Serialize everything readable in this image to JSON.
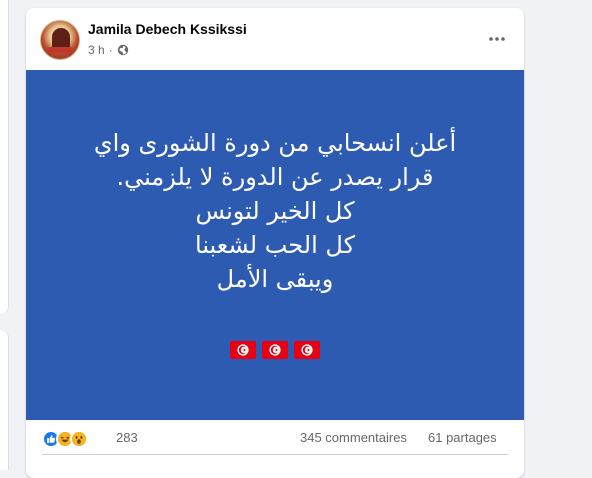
{
  "post": {
    "author": "Jamila Debech Kssikssi",
    "time": "3 h",
    "dot": "·",
    "privacy_icon": "globe-icon",
    "more_icon": "ellipsis-icon",
    "background_color": "#2e5bb2",
    "text_lines": [
      "أعلن انسحابي من دورة الشورى واي",
      "قرار يصدر عن الدورة لا يلزمني.",
      "كل الخير لتونس",
      "كل الحب لشعبنا",
      "ويبقى الأمل"
    ],
    "flags": [
      "tunisia-flag-icon",
      "tunisia-flag-icon",
      "tunisia-flag-icon"
    ]
  },
  "reactions": {
    "icons": [
      "like-icon",
      "haha-icon",
      "wow-icon"
    ],
    "count": "283",
    "comments": "345 commentaires",
    "shares": "61 partages"
  }
}
